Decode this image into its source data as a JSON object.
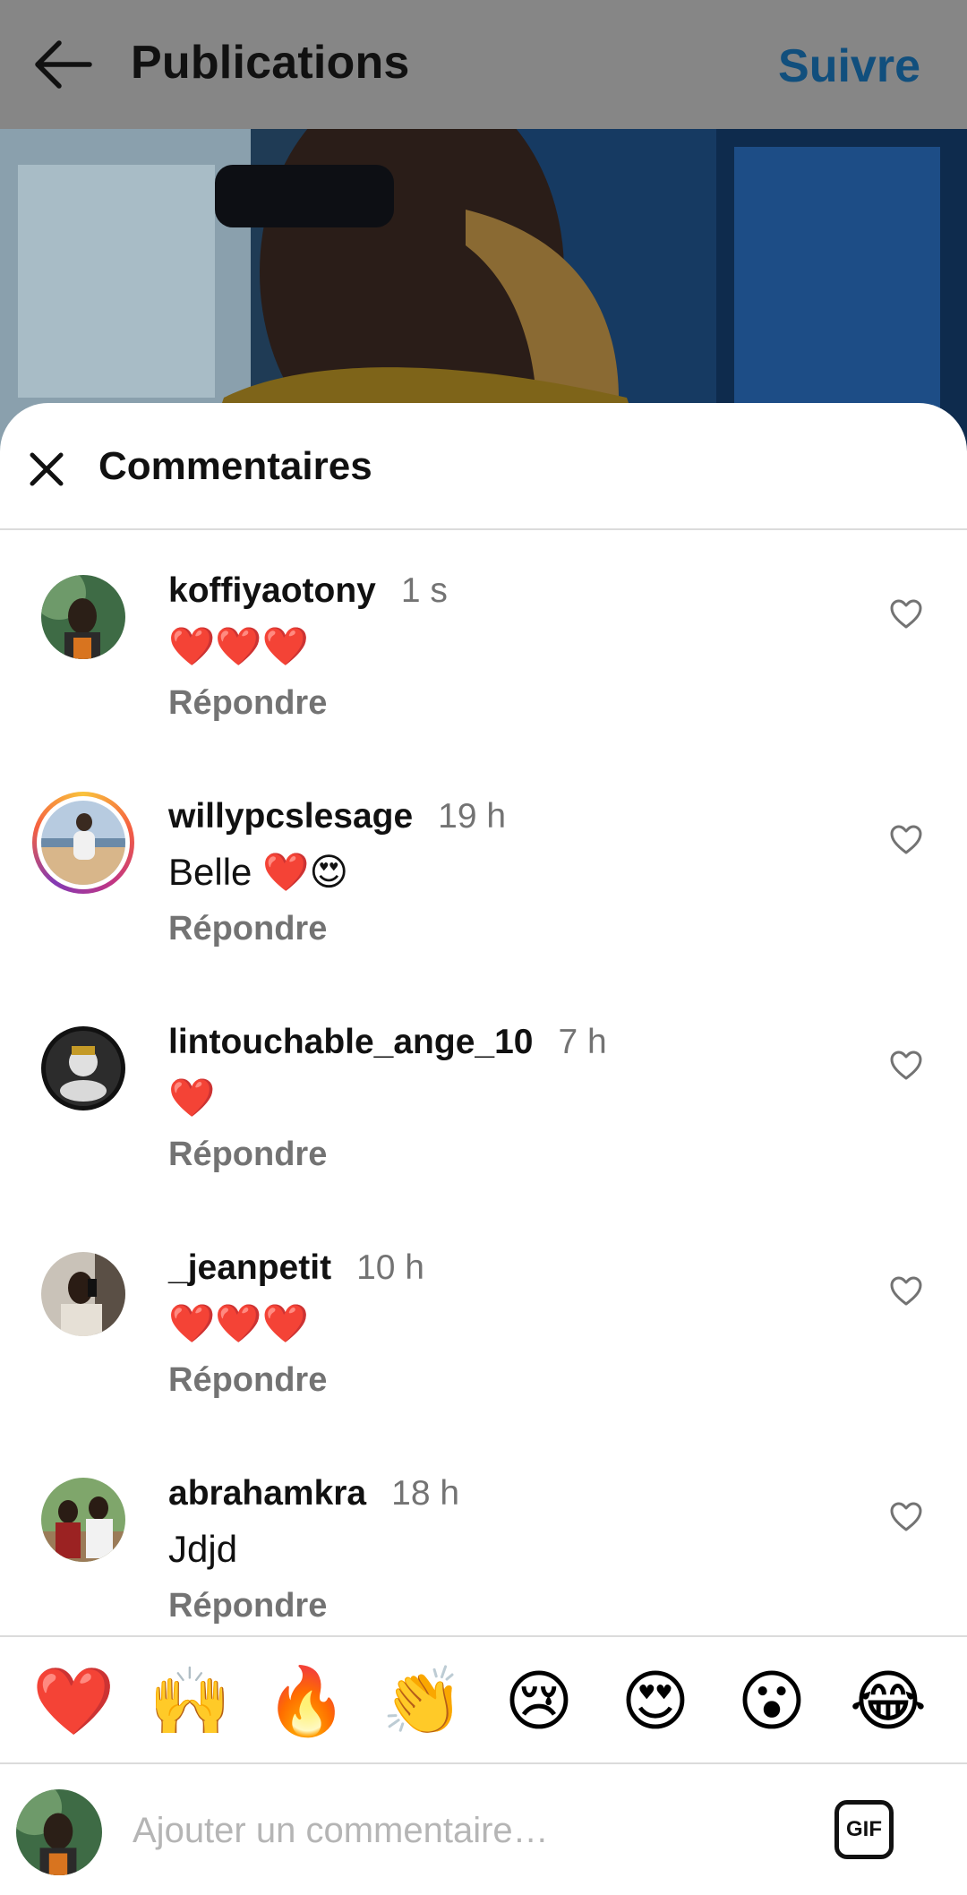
{
  "topbar": {
    "title": "Publications",
    "follow_label": "Suivre"
  },
  "sheet": {
    "title": "Commentaires"
  },
  "comments": [
    {
      "username": "koffiyaotony",
      "time": "1 s",
      "text": "❤️❤️❤️",
      "reply_label": "Répondre"
    },
    {
      "username": "willypcslesage",
      "time": "19 h",
      "text": "Belle ❤️😍",
      "reply_label": "Répondre"
    },
    {
      "username": "lintouchable_ange_10",
      "time": "7 h",
      "text": "❤️",
      "reply_label": "Répondre"
    },
    {
      "username": "_jeanpetit",
      "time": "10 h",
      "text": "❤️❤️❤️",
      "reply_label": "Répondre"
    },
    {
      "username": "abrahamkra",
      "time": "18 h",
      "text": "Jdjd",
      "reply_label": "Répondre"
    }
  ],
  "emoji_bar": [
    "❤️",
    "🙌",
    "🔥",
    "👏",
    "😢",
    "😍",
    "😮",
    "😂"
  ],
  "input": {
    "placeholder": "Ajouter un commentaire…",
    "gif_label": "GIF"
  },
  "icons": {
    "back": "arrow-left-icon",
    "close": "close-icon",
    "like": "heart-outline-icon"
  },
  "colors": {
    "follow": "#114f7d",
    "secondary_text": "#737373"
  }
}
